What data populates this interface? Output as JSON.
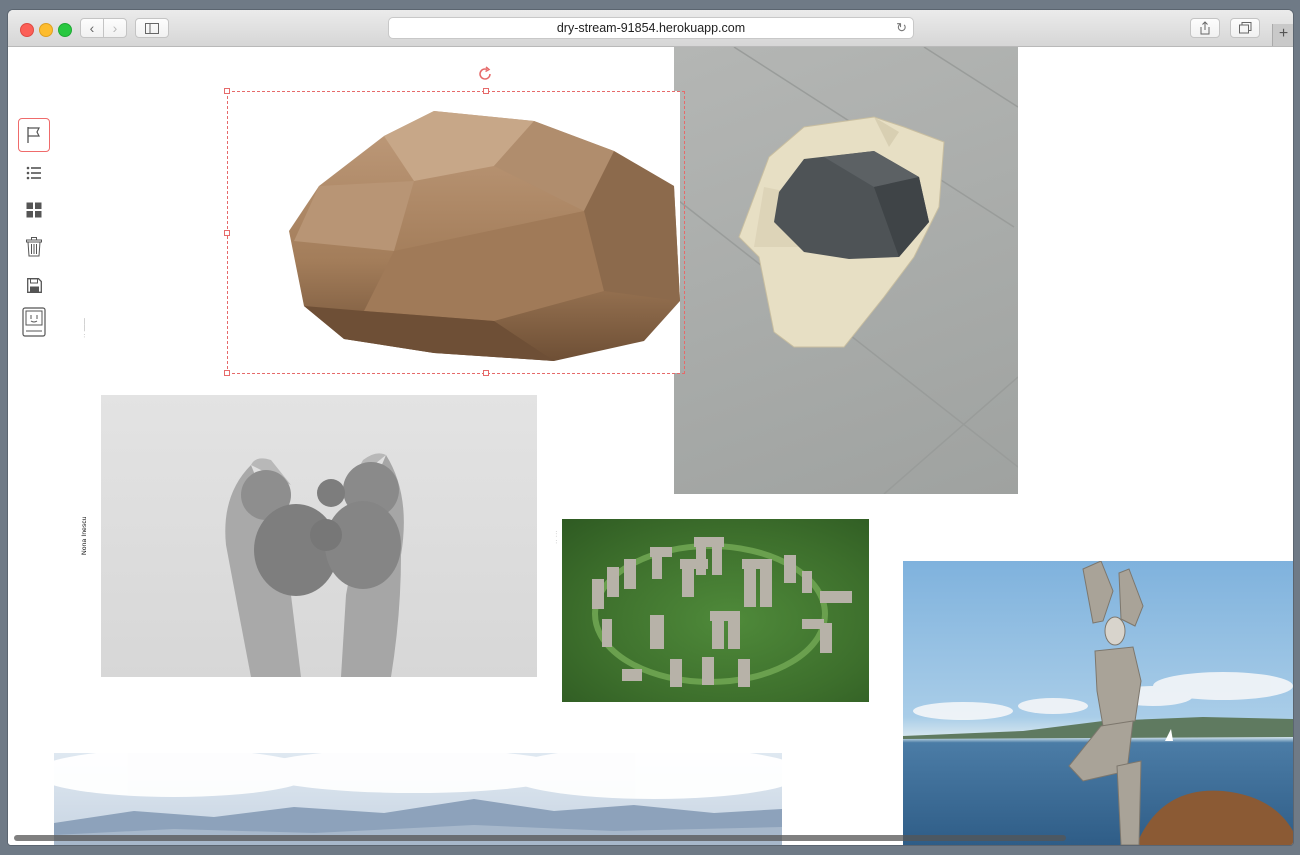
{
  "browser": {
    "url": "dry-stream-91854.herokuapp.com",
    "nav_back_icon": "chevron-left-icon",
    "nav_forward_icon": "chevron-right-icon",
    "reload_icon": "reload-icon",
    "new_tab_label": "+"
  },
  "tools": [
    {
      "name": "flag-tool",
      "icon": "flag-icon",
      "active": true
    },
    {
      "name": "list-tool",
      "icon": "list-icon",
      "active": false
    },
    {
      "name": "grid-tool",
      "icon": "grid-icon",
      "active": false
    },
    {
      "name": "trash-tool",
      "icon": "trash-icon",
      "active": false
    },
    {
      "name": "save-tool",
      "icon": "floppy-disk-icon",
      "active": false
    },
    {
      "name": "computer-tool",
      "icon": "computer-icon",
      "active": false
    }
  ],
  "labels": {
    "artist": "Nona Inescu"
  },
  "selection": {
    "rotate_icon": "rotate-icon",
    "accent": "#e66a6a"
  },
  "images": [
    {
      "name": "boulder-image",
      "description": "brown faceted boulder"
    },
    {
      "name": "rock-on-coat-image",
      "description": "dark rock on beige coat on tiled floor"
    },
    {
      "name": "hands-holding-stones-image",
      "description": "hands holding stones, black and white"
    },
    {
      "name": "stonehenge-image",
      "description": "aerial view of stone circle"
    },
    {
      "name": "stone-sculpture-image",
      "description": "balanced stone sculpture by the sea"
    },
    {
      "name": "mountain-landscape-image",
      "description": "mountains under clouds"
    }
  ]
}
